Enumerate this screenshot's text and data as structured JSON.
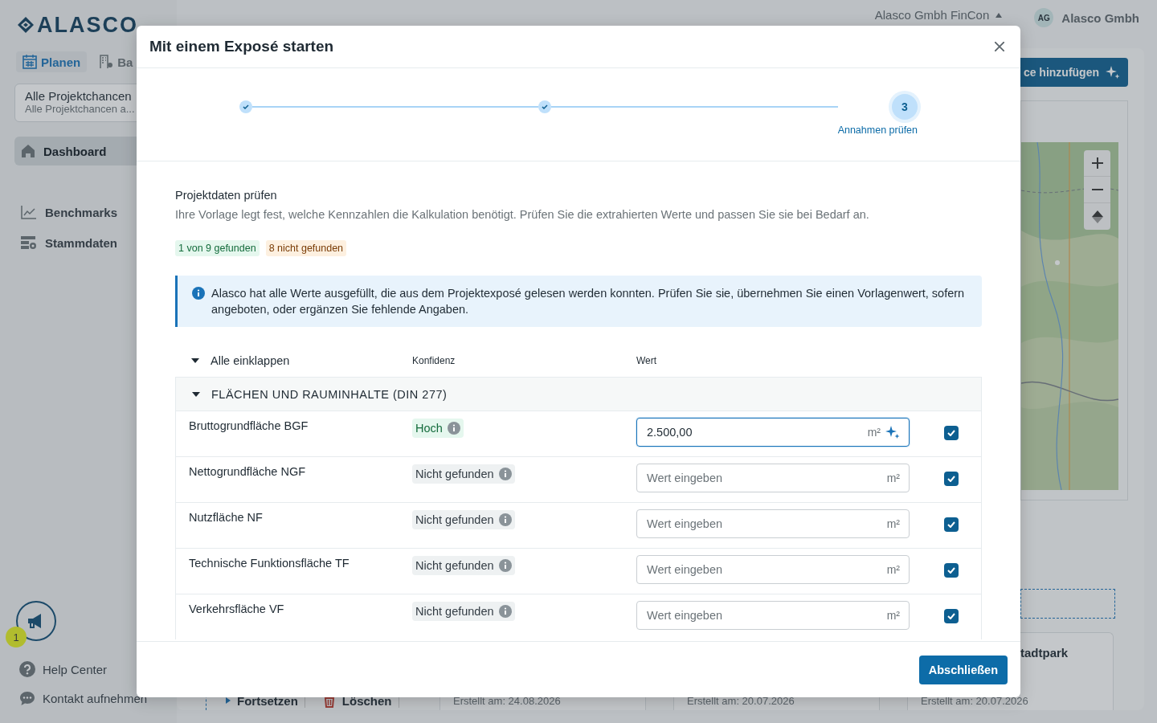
{
  "app": {
    "logo": "ALASCO",
    "tabs": [
      {
        "label": "Planen",
        "selected": true
      },
      {
        "label": "Ba",
        "selected": false
      }
    ],
    "project_selector": {
      "title": "Alle Projektchancen",
      "subtitle": "Alle Projektchancen a..."
    },
    "nav": [
      {
        "label": "Dashboard",
        "selected": true
      },
      {
        "label": "Benchmarks",
        "selected": false
      },
      {
        "label": "Stammdaten",
        "selected": false
      }
    ],
    "announcements": {
      "badge": "1"
    },
    "help_links": [
      {
        "label": "Help Center"
      },
      {
        "label": "Kontakt aufnehmen"
      }
    ],
    "header": {
      "company": "Alasco Gmbh FinCon",
      "avatar": "AG",
      "user": "Alasco Gmbh"
    },
    "add_button": "ce hinzufügen",
    "list_actions": [
      {
        "label": "Fortsetzen"
      },
      {
        "label": "Löschen"
      }
    ],
    "cards": [
      {
        "created": "Erstellt am: 24.08.2026"
      },
      {
        "created": "Erstellt am: 20.07.2026"
      },
      {
        "title": "tadtpark",
        "created": "Erstellt am: 20.07.2026"
      }
    ]
  },
  "modal": {
    "title": "Mit einem Exposé starten",
    "steps": [
      {
        "completed": true
      },
      {
        "completed": true
      },
      {
        "completed": false,
        "number": "3",
        "label": "Annahmen prüfen"
      }
    ],
    "section_title": "Projektdaten prüfen",
    "description": "Ihre Vorlage legt fest, welche Kennzahlen die Kalkulation benötigt. Prüfen Sie die extrahierten Werte und passen Sie sie bei Bedarf an.",
    "badges": [
      {
        "label": "1 von 9 gefunden",
        "kind": "success"
      },
      {
        "label": "8 nicht gefunden",
        "kind": "warning"
      }
    ],
    "info": "Alasco hat alle Werte ausgefüllt, die aus dem Projektexposé gelesen werden konnten. Prüfen Sie sie, übernehmen Sie einen Vorlagenwert, sofern angeboten, oder ergänzen Sie fehlende Angaben.",
    "table": {
      "collapse_all": "Alle einklappen",
      "columns": [
        "Konfidenz",
        "Wert"
      ],
      "groups": [
        {
          "title": "FLÄCHEN UND RAUMINHALTE (DIN 277)",
          "expanded": true,
          "rows": [
            {
              "name": "Bruttogrundfläche BGF",
              "confidence": {
                "label": "Hoch",
                "kind": "high"
              },
              "value": "2.500,00",
              "unit": "m²",
              "ai_filled": true,
              "checked": true
            },
            {
              "name": "Nettogrundfläche NGF",
              "confidence": {
                "label": "Nicht gefunden",
                "kind": "none"
              },
              "placeholder": "Wert eingeben",
              "unit": "m²",
              "ai_filled": false,
              "checked": true
            },
            {
              "name": "Nutzfläche NF",
              "confidence": {
                "label": "Nicht gefunden",
                "kind": "none"
              },
              "placeholder": "Wert eingeben",
              "unit": "m²",
              "ai_filled": false,
              "checked": true
            },
            {
              "name": "Technische Funktionsfläche TF",
              "confidence": {
                "label": "Nicht gefunden",
                "kind": "none"
              },
              "placeholder": "Wert eingeben",
              "unit": "m²",
              "ai_filled": false,
              "checked": true
            },
            {
              "name": "Verkehrsfläche VF",
              "confidence": {
                "label": "Nicht gefunden",
                "kind": "none"
              },
              "placeholder": "Wert eingeben",
              "unit": "m²",
              "ai_filled": false,
              "checked": true
            }
          ]
        }
      ]
    },
    "finish_button": "Abschließen"
  }
}
